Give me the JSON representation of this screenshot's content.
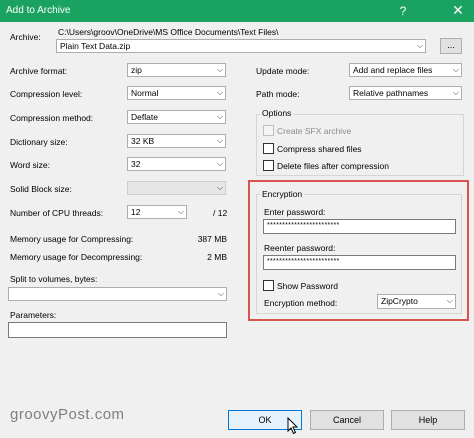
{
  "window": {
    "title": "Add to Archive",
    "help_icon": "?",
    "close_icon": "✕"
  },
  "archive": {
    "label": "Archive:",
    "path": "C:\\Users\\groov\\OneDrive\\MS Office Documents\\Text Files\\",
    "filename": "Plain Text Data.zip",
    "browse_label": "..."
  },
  "left": {
    "archive_format": {
      "label": "Archive format:",
      "value": "zip"
    },
    "compression_level": {
      "label": "Compression level:",
      "value": "Normal"
    },
    "compression_method": {
      "label": "Compression method:",
      "value": "Deflate"
    },
    "dictionary_size": {
      "label": "Dictionary size:",
      "value": "32 KB"
    },
    "word_size": {
      "label": "Word size:",
      "value": "32"
    },
    "solid_block_size": {
      "label": "Solid Block size:",
      "value": ""
    },
    "cpu_threads": {
      "label": "Number of CPU threads:",
      "value": "12",
      "max": "/ 12"
    },
    "mem_compress": {
      "label": "Memory usage for Compressing:",
      "value": "387 MB"
    },
    "mem_decompress": {
      "label": "Memory usage for Decompressing:",
      "value": "2 MB"
    },
    "split": {
      "label": "Split to volumes, bytes:",
      "value": ""
    },
    "parameters": {
      "label": "Parameters:",
      "value": ""
    }
  },
  "right": {
    "update_mode": {
      "label": "Update mode:",
      "value": "Add and replace files"
    },
    "path_mode": {
      "label": "Path mode:",
      "value": "Relative pathnames"
    },
    "options": {
      "title": "Options",
      "create_sfx": "Create SFX archive",
      "compress_shared": "Compress shared files",
      "delete_after": "Delete files after compression"
    },
    "encryption": {
      "title": "Encryption",
      "enter_label": "Enter password:",
      "enter_value": "************************",
      "reenter_label": "Reenter password:",
      "reenter_value": "************************",
      "show_password": "Show Password",
      "method_label": "Encryption method:",
      "method_value": "ZipCrypto"
    }
  },
  "buttons": {
    "ok": "OK",
    "cancel": "Cancel",
    "help": "Help"
  },
  "watermark": "groovyPost.com",
  "icons": {
    "dropdown": "chevron-down-icon",
    "cursor": "mouse-pointer-icon"
  },
  "colors": {
    "titlebar": "#1aa260",
    "highlight_box": "#d9534f"
  }
}
